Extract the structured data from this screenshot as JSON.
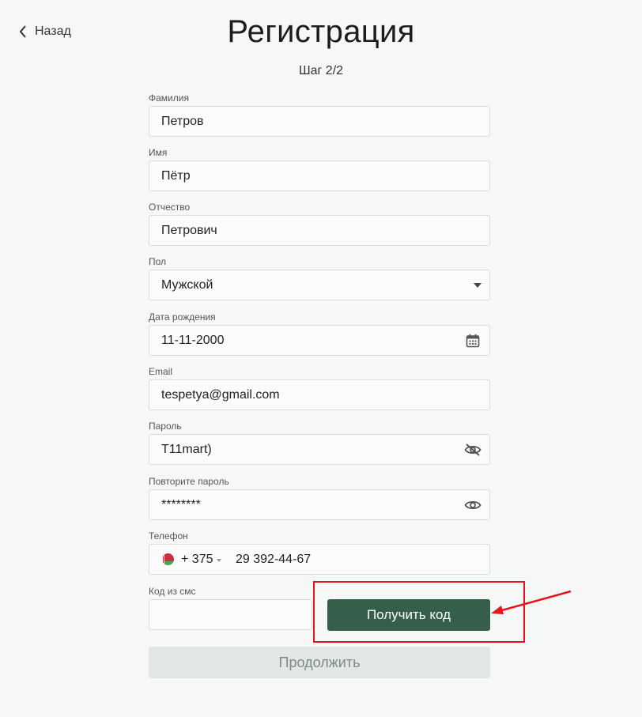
{
  "nav": {
    "back_label": "Назад"
  },
  "header": {
    "title": "Регистрация",
    "step": "Шаг 2/2"
  },
  "form": {
    "last_name": {
      "label": "Фамилия",
      "value": "Петров"
    },
    "first_name": {
      "label": "Имя",
      "value": "Пётр"
    },
    "patronymic": {
      "label": "Отчество",
      "value": "Петрович"
    },
    "gender": {
      "label": "Пол",
      "value": "Мужской"
    },
    "birth_date": {
      "label": "Дата рождения",
      "value": "11-11-2000"
    },
    "email": {
      "label": "Email",
      "value": "tespetya@gmail.com"
    },
    "password": {
      "label": "Пароль",
      "value": "T11mart)"
    },
    "password_repeat": {
      "label": "Повторите пароль",
      "value": "********"
    },
    "phone": {
      "label": "Телефон",
      "country_code": "+ 375",
      "number": "29 392-44-67"
    },
    "sms_code": {
      "label": "Код из смс",
      "value": ""
    }
  },
  "buttons": {
    "get_code": "Получить код",
    "continue": "Продолжить"
  },
  "colors": {
    "primary": "#355e4b",
    "annotation": "#e8131b",
    "disabled_bg": "#e2e6e6"
  },
  "icons": {
    "back": "chevron-left-icon",
    "gender": "caret-down-icon",
    "birth_date": "calendar-icon",
    "password": "eye-slash-icon",
    "password_repeat": "eye-icon",
    "phone": "belarus-flag-icon"
  }
}
